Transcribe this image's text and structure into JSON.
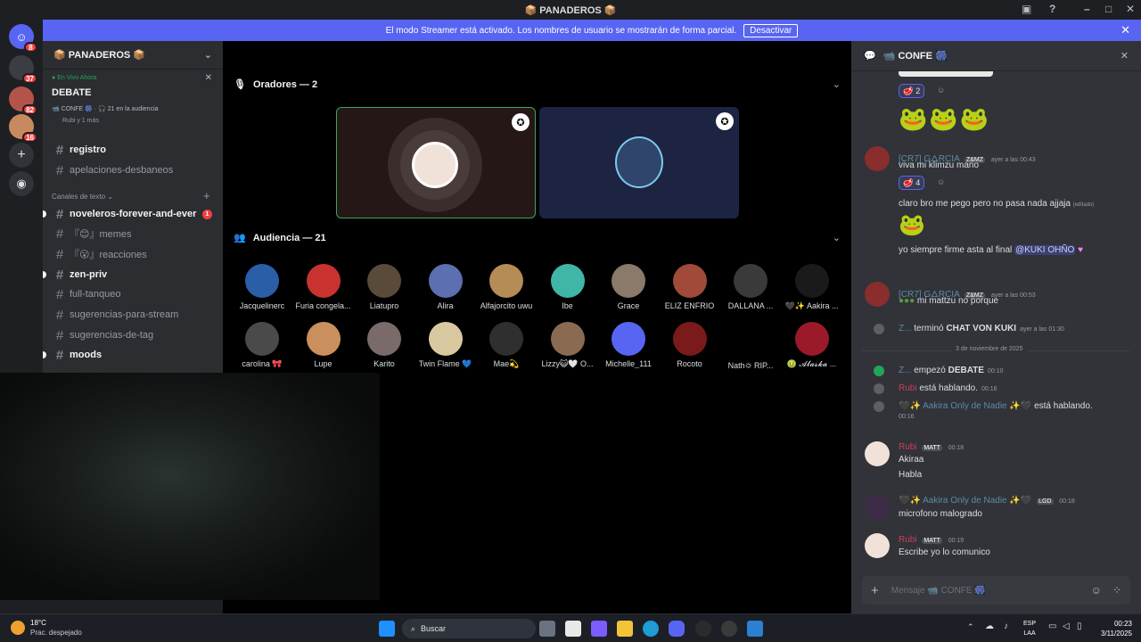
{
  "window": {
    "title": "📦 PANADEROS 📦"
  },
  "banner": {
    "text": "El modo Streamer está activado. Los nombres de usuario se mostrarán de forma parcial.",
    "button": "Desactivar"
  },
  "rail": {
    "badges": [
      "8",
      "37",
      "82",
      "16"
    ]
  },
  "sidebar": {
    "guild_name": "📦 PANADEROS 📦",
    "live": {
      "label": "En Vivo Ahora",
      "title": "DEBATE",
      "meta": "📹 CONFE 🎆  ·  🎧 21 en la audiencia",
      "speakers": "Rubi y 1 más"
    },
    "channels_top": [
      "registro",
      "apelaciones-desbaneos"
    ],
    "category": "Canales de texto",
    "channels": [
      {
        "name": "noveleros-forever-and-ever",
        "unread": true,
        "mention": "1"
      },
      {
        "name": "『😊』memes",
        "unread": false
      },
      {
        "name": "『😮』reacciones",
        "unread": false
      },
      {
        "name": "zen-priv",
        "unread": true
      },
      {
        "name": "full-tanqueo",
        "unread": false
      },
      {
        "name": "sugerencias-para-stream",
        "unread": false
      },
      {
        "name": "sugerencias-de-tag",
        "unread": false
      },
      {
        "name": "moods",
        "unread": true
      }
    ]
  },
  "stage": {
    "speakers_label": "Oradores — 2",
    "audience_label": "Audiencia — 21",
    "audience_row1": [
      "Jacquelinerc",
      "Furia congela...",
      "Liatupro",
      "Alira",
      "Alfajorcito uwu",
      "Ibe",
      "Grace",
      "ELIZ ENFRIO",
      "DALLANA ...",
      "🖤✨ Aakira ..."
    ],
    "audience_row2": [
      "carolina 🎀",
      "Lupe",
      "Karito",
      "Twin Flame 💙",
      "Mae💫",
      "Lizzy😺🤍 O...",
      "Michelle_111",
      "Rocoto",
      "Nath🌣 RIP...",
      "🤢 𝓐𝓵𝓪𝓼𝓴𝓪 ..."
    ]
  },
  "chat": {
    "channel": "📹 CONFE 🎆",
    "reaction1": "2",
    "reaction2": "4",
    "msg1_user": "[CR7] G🜂RCIA",
    "msg1_tag": "Z&MZ",
    "msg1_time": "ayer a las 00:43",
    "msg1_text": "viva mi klimzu mano",
    "msg1_text2": "claro bro me pego pero no pasa nada ajjaja",
    "edited": "(editado)",
    "msg1_text3": "yo siempre firme asta al final",
    "mention": "@KUKI OHÑO",
    "msg2_user": "[CR7] G🜂RCIA",
    "msg2_tag": "Z&MZ",
    "msg2_time": "ayer a las 00:53",
    "msg2_text": "mi mattzu no  porque",
    "sys1_user": "Z...",
    "sys1_text": "terminó",
    "sys1_bold": "CHAT VON KUKI",
    "sys1_time": "ayer a las 01:30",
    "divider": "3 de noviembre de 2025",
    "sys2_user": "Z...",
    "sys2_text": "empezó",
    "sys2_bold": "DEBATE",
    "sys2_time": "00:10",
    "sys3_user": "Rubi",
    "sys3_text": "está hablando.",
    "sys3_time": "00:16",
    "sys4_user": "🖤✨ Aakira Only de Nadie ✨🖤",
    "sys4_text": "está hablando.",
    "sys4_time": "00:16",
    "msg3_user": "Rubi",
    "msg3_tag": "MATT",
    "msg3_time": "00:18",
    "msg3_text1": "Akiraa",
    "msg3_text2": "Habla",
    "msg4_user": "🖤✨ Aakira Only de Nadie ✨🖤",
    "msg4_tag": "LGD",
    "msg4_time": "00:18",
    "msg4_text": "microfono malogrado",
    "msg5_user": "Rubi",
    "msg5_tag": "MATT",
    "msg5_time": "00:19",
    "msg5_text": "Escribe yo lo comunico",
    "input_placeholder": "Mensaje 📹 CONFE 🎆"
  },
  "taskbar": {
    "weather_temp": "18°C",
    "weather_desc": "Prac. despejado",
    "search": "Buscar",
    "lang1": "ESP",
    "lang2": "LAA",
    "time": "00:23",
    "date": "3/11/2025"
  },
  "colors": {
    "accent": "#5865f2",
    "mention_red": "#f23f43",
    "green": "#23a55a",
    "pink": "#f47fff"
  }
}
